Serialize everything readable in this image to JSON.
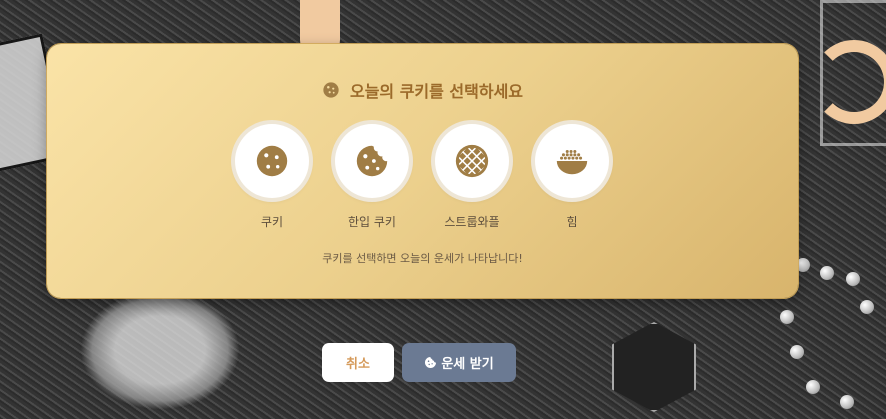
{
  "dialog": {
    "title": "오늘의 쿠키를 선택하세요",
    "hint": "쿠키를 선택하면 오늘의 운세가 나타납니다!",
    "options": [
      {
        "label": "쿠키",
        "icon": "cookie-icon"
      },
      {
        "label": "한입 쿠키",
        "icon": "bitten-cookie-icon"
      },
      {
        "label": "스트룹와플",
        "icon": "stroopwafel-icon"
      },
      {
        "label": "힘",
        "icon": "rice-bowl-icon"
      }
    ]
  },
  "buttons": {
    "cancel": "취소",
    "confirm": "운세 받기"
  },
  "colors": {
    "panel_start": "#fae3a7",
    "panel_end": "#d8b46c",
    "title": "#9b6a2a",
    "icon": "#a07d45",
    "confirm_bg": "#6b7a93",
    "cancel_text": "#d59a5a"
  }
}
